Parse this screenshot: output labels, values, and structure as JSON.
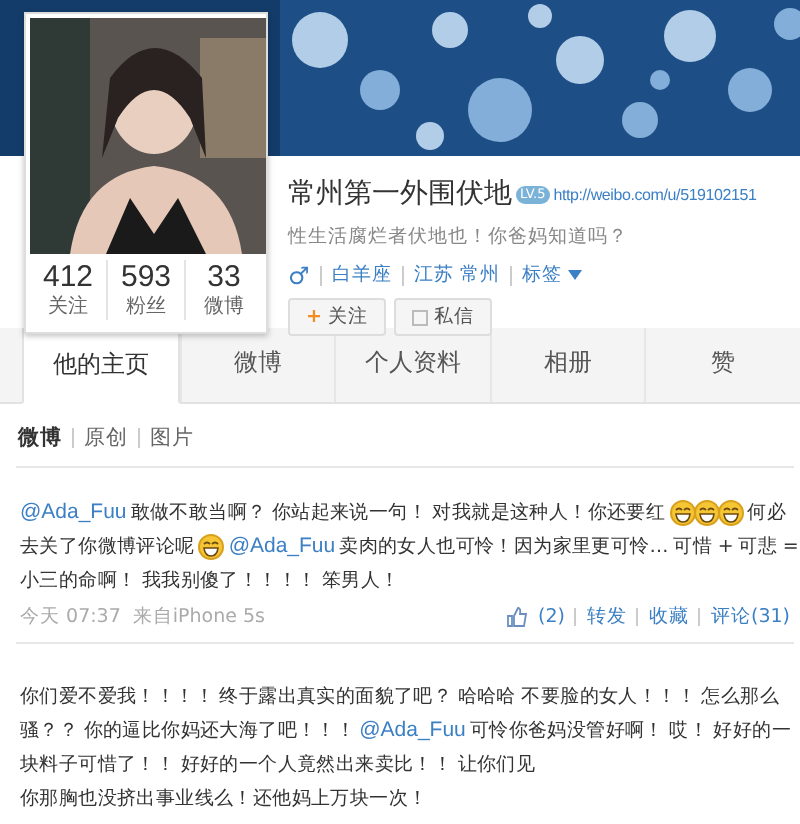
{
  "profile": {
    "name": "常州第一外围伏地",
    "badge": "LV.5",
    "url": "http://weibo.com/u/519102151",
    "bio": "性生活腐烂者伏地也！你爸妈知道吗？",
    "gender": "♂",
    "meta": [
      "白羊座",
      "江苏 常州",
      "标签"
    ],
    "stats": [
      {
        "value": "412",
        "label": "关注"
      },
      {
        "value": "593",
        "label": "粉丝"
      },
      {
        "value": "33",
        "label": "微博"
      }
    ],
    "buttons": [
      {
        "kind": "follow",
        "label": "关注",
        "icon": "+"
      },
      {
        "kind": "message",
        "label": "私信"
      }
    ]
  },
  "tabs": [
    {
      "label": "他的主页",
      "selected": true
    },
    {
      "label": "微博",
      "selected": false
    },
    {
      "label": "个人资料",
      "selected": false
    },
    {
      "label": "相册",
      "selected": false
    },
    {
      "label": "赞",
      "selected": false
    }
  ],
  "filters": [
    {
      "label": "微博",
      "selected": true
    },
    {
      "label": "原创",
      "selected": false
    },
    {
      "label": "图片",
      "selected": false
    }
  ],
  "posts": [
    {
      "lines": [
        [
          {
            "kind": "mention",
            "text": "@Ada_Fuu"
          },
          {
            "kind": "text",
            "text": "敢做不敢当啊？ 你站起来说一句！ 对我就是这种人！你还要红"
          },
          {
            "kind": "emoji"
          },
          {
            "kind": "emoji"
          },
          {
            "kind": "emoji"
          },
          {
            "kind": "text",
            "text": "何必"
          }
        ],
        [
          {
            "kind": "text",
            "text": "去关了你微博评论呢"
          },
          {
            "kind": "emoji"
          },
          {
            "kind": "mention",
            "text": "@Ada_Fuu"
          },
          {
            "kind": "text",
            "text": "卖肉的女人也可怜！因为家里更可怜… 可惜 + 可悲 ="
          }
        ],
        [
          {
            "kind": "text",
            "text": "小三的命啊！ 我我别傻了！！！！ 笨男人！"
          }
        ]
      ],
      "time": "今天 07:37",
      "source": "来自iPhone 5s",
      "actions": [
        {
          "kind": "like",
          "label": "(2)"
        },
        {
          "kind": "text",
          "label": "转发"
        },
        {
          "kind": "text",
          "label": "收藏"
        },
        {
          "kind": "text",
          "label": "评论(31)"
        }
      ]
    },
    {
      "lines": [
        [
          {
            "kind": "text",
            "text": "你们爱不爱我！！！！ 终于露出真实的面貌了吧？ 哈哈哈 不要脸的女人！！！ 怎么那么"
          }
        ],
        [
          {
            "kind": "text",
            "text": "骚？？ 你的逼比你妈还大海了吧！！！"
          },
          {
            "kind": "mention",
            "text": "@Ada_Fuu"
          },
          {
            "kind": "text",
            "text": "可怜你爸妈没管好啊！ 哎！ 好好的一"
          }
        ],
        [
          {
            "kind": "text",
            "text": "块料子可惜了！！ 好好的一个人竟然出来卖比！！ 让你们见"
          }
        ],
        [
          {
            "kind": "text",
            "text": "你那胸也没挤出事业线么！还他妈上万块一次！"
          }
        ]
      ]
    }
  ]
}
